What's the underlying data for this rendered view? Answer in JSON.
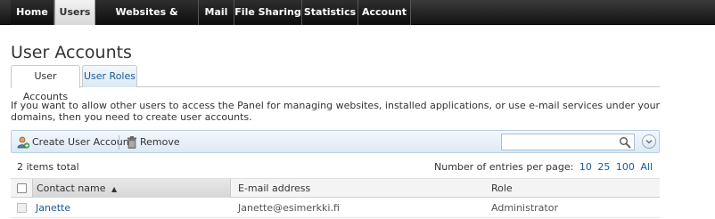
{
  "nav": {
    "tabs": [
      {
        "label": "Home"
      },
      {
        "label": "Users"
      },
      {
        "label": "Websites & Domains"
      },
      {
        "label": "Mail"
      },
      {
        "label": "File Sharing"
      },
      {
        "label": "Statistics"
      },
      {
        "label": "Account"
      }
    ],
    "active_index": 1
  },
  "page": {
    "title": "User Accounts",
    "subtabs": [
      {
        "label": "User Accounts"
      },
      {
        "label": "User Roles"
      }
    ],
    "description": "If you want to allow other users to access the Panel for managing websites, installed applications, or use e-mail services under your domains, then you need to create user accounts."
  },
  "toolbar": {
    "create_label": "Create User Account",
    "remove_label": "Remove",
    "search_placeholder": ""
  },
  "list": {
    "total": "2 items total",
    "per_page_label": "Number of entries per page:",
    "per_page_options": [
      "10",
      "25",
      "100",
      "All"
    ],
    "columns": {
      "name": "Contact name",
      "email": "E-mail address",
      "role": "Role"
    },
    "sort_indicator": "▲",
    "rows": [
      {
        "name": "Janette",
        "email": "Janette@esimerkki.fi",
        "role": "Administrator"
      }
    ]
  },
  "colors": {
    "link": "#1a5a9a",
    "nav_bg": "#141414"
  }
}
